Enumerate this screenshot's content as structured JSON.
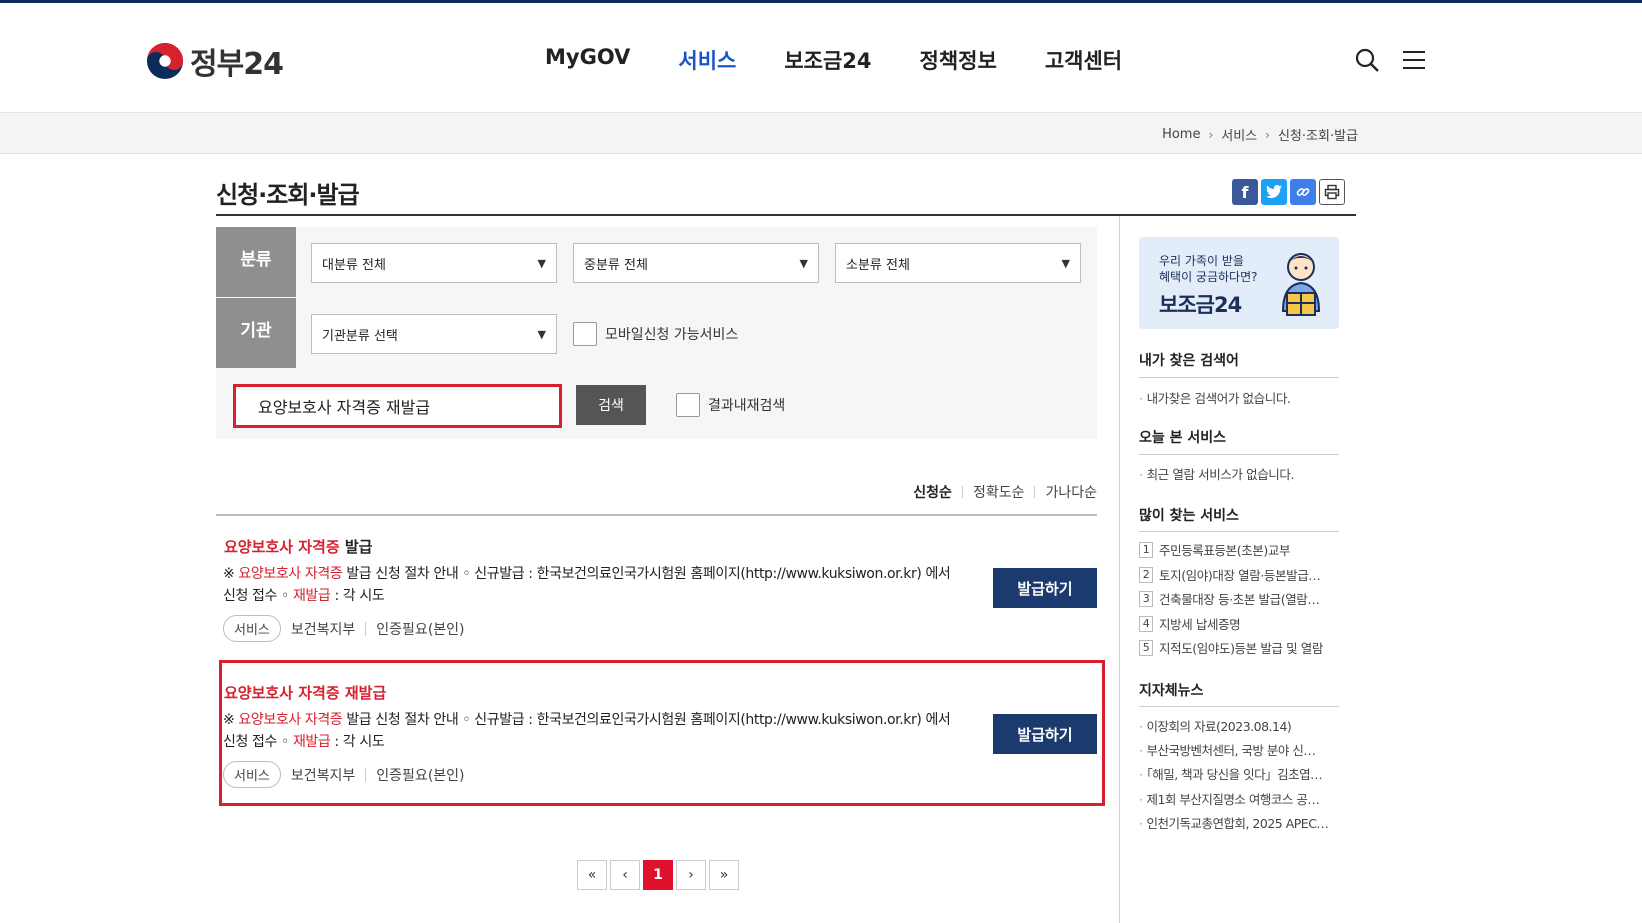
{
  "header": {
    "logo": "정부24",
    "nav": [
      "MyGOV",
      "서비스",
      "보조금24",
      "정책정보",
      "고객센터"
    ],
    "active_nav": "서비스"
  },
  "breadcrumb": [
    "Home",
    "서비스",
    "신청·조회·발급"
  ],
  "page": {
    "title": "신청·조회·발급"
  },
  "filters": {
    "category_label": "분류",
    "agency_label": "기관",
    "major": "대분류 전체",
    "middle": "중분류 전체",
    "minor": "소분류 전체",
    "agency": "기관분류 선택",
    "mobile_label": "모바일신청 가능서비스",
    "search_value": "요양보호사 자격증 재발급",
    "search_button": "검색",
    "within_label": "결과내재검색"
  },
  "sort": [
    "신청순",
    "정확도순",
    "가나다순"
  ],
  "results": [
    {
      "title_red": "요양보호사 자격증",
      "title_rest": " 발급",
      "desc_pre": "※ ",
      "desc_red1": "요양보호사 자격증",
      "desc_mid": " 발급 신청 절차 안내 ◦ 신규발급 : 한국보건의료인국가시험원 홈페이지(http://www.kuksiwon.or.kr) 에서 신청 접수 ◦ ",
      "desc_red2": "재발급",
      "desc_end": " : 각 시도",
      "tag": "서비스",
      "agency": "보건복지부",
      "auth": "인증필요(본인)",
      "button": "발급하기"
    },
    {
      "title_red": "요양보호사 자격증 재발급",
      "title_rest": "",
      "desc_pre": "※ ",
      "desc_red1": "요양보호사 자격증",
      "desc_mid": " 발급 신청 절차 안내 ◦ 신규발급 : 한국보건의료인국가시험원 홈페이지(http://www.kuksiwon.or.kr) 에서 신청 접수 ◦ ",
      "desc_red2": "재발급",
      "desc_end": " : 각 시도",
      "tag": "서비스",
      "agency": "보건복지부",
      "auth": "인증필요(본인)",
      "button": "발급하기"
    }
  ],
  "pagination": {
    "first": "«",
    "prev": "‹",
    "current": "1",
    "next": "›",
    "last": "»"
  },
  "sidebar": {
    "banner_line1": "우리 가족이 받을",
    "banner_line2": "혜택이 궁금하다면?",
    "banner_title": "보조금24",
    "my_search_title": "내가 찾은 검색어",
    "my_search_empty": "내가찾은 검색어가 없습니다.",
    "today_title": "오늘 본 서비스",
    "today_empty": "최근 열람 서비스가 없습니다.",
    "popular_title": "많이 찾는 서비스",
    "popular": [
      "주민등록표등본(초본)교부",
      "토지(임야)대장 열람·등본발급…",
      "건축물대장 등·초본 발급(열람…",
      "지방세 납세증명",
      "지적도(임야도)등본 발급 및 열람"
    ],
    "news_title": "지자체뉴스",
    "news": [
      "이장회의 자료(2023.08.14)",
      "부산국방벤처센터, 국방 분야 신…",
      "「해밀, 책과 당신을 잇다」김초엽…",
      "제1회 부산지질명소 여행코스 공…",
      "인천기독교총연합회, 2025 APEC…"
    ]
  }
}
